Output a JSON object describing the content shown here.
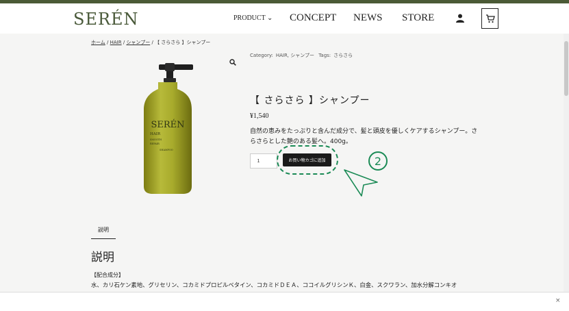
{
  "brand": {
    "logo": "SERÉN",
    "logo_color": "#4a5a3a"
  },
  "nav": {
    "product": "PRODUCT ⌄",
    "concept": "CONCEPT",
    "news": "NEWS",
    "store": "STORE"
  },
  "breadcrumb": {
    "home": "ホーム",
    "hair": "HAIR",
    "shampoo": "シャンプー",
    "current": "【 さらさら 】シャンプー",
    "sep": "/"
  },
  "product": {
    "category_label": "Category:",
    "categories": "HAIR, シャンプー",
    "tags_label": "Tags:",
    "tags": "さらさら",
    "title": "【 さらさら 】シャンプー",
    "price": "¥1,540",
    "description": "自然の恵みをたっぷりと含んだ成分で、髪と頭皮を優しくケアするシャンプー。さらさらとした艶のある髪へ。400g。",
    "quantity": "1",
    "add_to_cart": "お買い物カゴに追加",
    "bottle_label": {
      "brand": "SERÉN",
      "line1": "HAIR",
      "line2": "SMOOTH",
      "line3": "REPAIR",
      "line4": "SHAMPOO"
    }
  },
  "annotation": {
    "step": "2",
    "color": "#1a8a55"
  },
  "tabs": {
    "description": "説明"
  },
  "details": {
    "title": "説明",
    "ingredients_heading": "【配合成分】",
    "ingredients": "水、カリ石ケン素地、グリセリン、コカミドプロピルベタイン、コカミドＤＥＡ、ココイルグリシンＫ、白金、スクワラン、加水分解コンキオ"
  },
  "footer": {
    "close": "×"
  }
}
